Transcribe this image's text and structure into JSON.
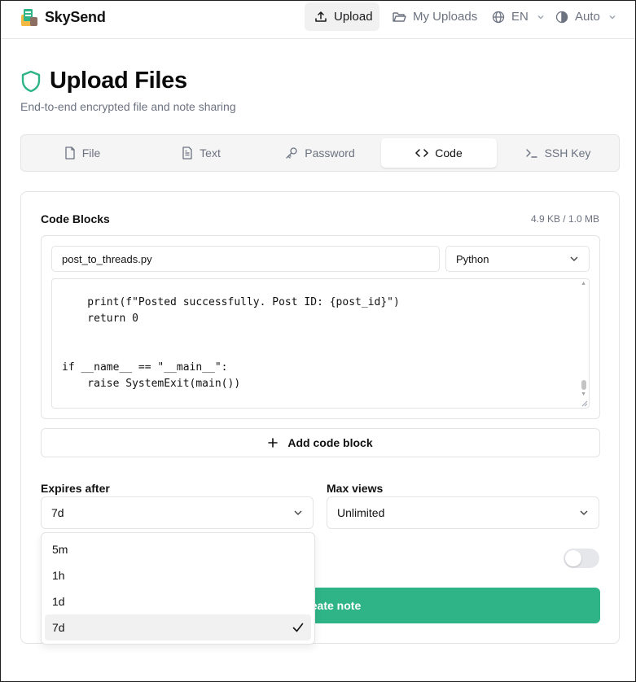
{
  "app": {
    "name": "SkySend"
  },
  "nav": {
    "upload": "Upload",
    "my_uploads": "My Uploads",
    "language": "EN",
    "theme": "Auto"
  },
  "hero": {
    "title": "Upload Files",
    "subtitle": "End-to-end encrypted file and note sharing"
  },
  "tabs": [
    {
      "label": "File",
      "icon": "file-icon"
    },
    {
      "label": "Text",
      "icon": "text-icon"
    },
    {
      "label": "Password",
      "icon": "key-icon"
    },
    {
      "label": "Code",
      "icon": "code-icon",
      "active": true
    },
    {
      "label": "SSH Key",
      "icon": "terminal-icon"
    }
  ],
  "code_blocks": {
    "title": "Code Blocks",
    "size": "4.9 KB / 1.0 MB",
    "filename": "post_to_threads.py",
    "language": "Python",
    "code_lines": [
      "    print(f\"Posted successfully. Post ID: {post_id}\")",
      "    return 0",
      "",
      "",
      "if __name__ == \"__main__\":",
      "    raise SystemExit(main())"
    ],
    "add_label": "Add code block"
  },
  "expires": {
    "label": "Expires after",
    "value": "7d",
    "options": [
      "5m",
      "1h",
      "1d",
      "7d"
    ],
    "selected": "7d"
  },
  "max_views": {
    "label": "Max views",
    "value": "Unlimited"
  },
  "submit": {
    "label": "eate note"
  },
  "colors": {
    "accent": "#2fb487",
    "muted": "#6b7280",
    "border": "#e4e4e7"
  }
}
